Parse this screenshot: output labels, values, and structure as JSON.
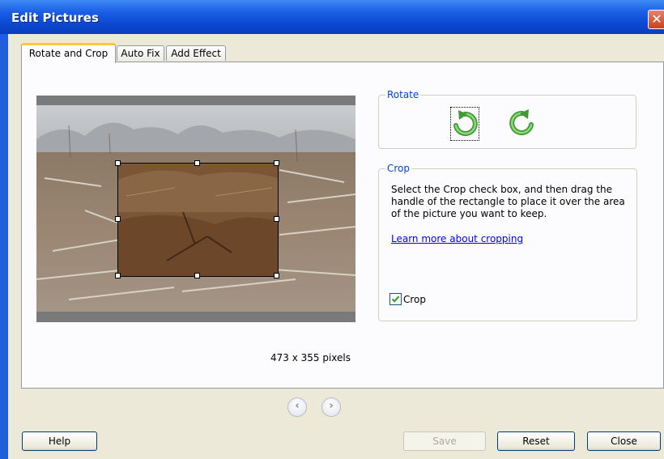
{
  "window": {
    "title": "Edit Pictures"
  },
  "tabs": [
    {
      "label": "Rotate and Crop",
      "active": true
    },
    {
      "label": "Auto Fix",
      "active": false
    },
    {
      "label": "Add Effect",
      "active": false
    }
  ],
  "picture": {
    "size_label": "473 x 355 pixels"
  },
  "rotate": {
    "legend": "Rotate",
    "left_icon": "rotate-left-icon",
    "right_icon": "rotate-right-icon"
  },
  "crop": {
    "legend": "Crop",
    "description": "Select the Crop check box, and then drag the handle of the rectangle to place it over the area of the picture you want to keep.",
    "link": "Learn more about cropping",
    "checkbox_label": "Crop",
    "checked": true
  },
  "navigation": {
    "prev_icon": "chevron-left-icon",
    "next_icon": "chevron-right-icon"
  },
  "buttons": {
    "help": "Help",
    "save": "Save",
    "reset": "Reset",
    "close": "Close"
  },
  "colors": {
    "title_bar": "#0c48d2",
    "accent": "#0046d5",
    "rotate_arrow": "#4caf3f"
  }
}
